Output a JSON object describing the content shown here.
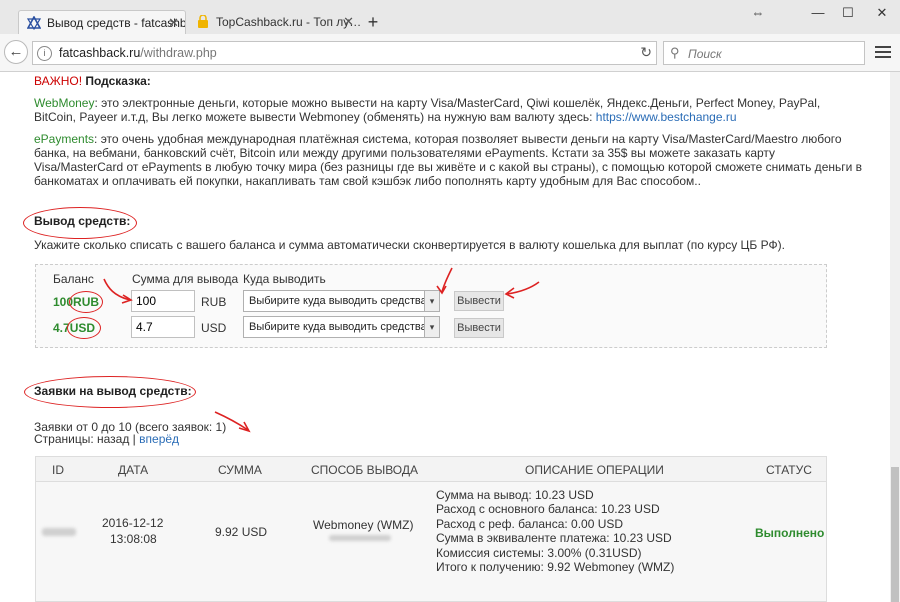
{
  "browser": {
    "tabs": [
      {
        "title": "Вывод средств - fatcashb…",
        "active": true
      },
      {
        "title": "TopCashback.ru - Топ лу…",
        "active": false
      }
    ],
    "new_tab": "+",
    "url_domain": "fatcashback.ru",
    "url_path": "/withdraw.php",
    "search_placeholder": "Поиск"
  },
  "hint": {
    "important": "ВАЖНО!",
    "label": "Подсказка:",
    "webmoney_name": "WebMoney",
    "webmoney_text": ": это электронные деньги, которые можно вывести на карту Visa/MasterCard, Qiwi кошелёк, Яндекс.Деньги, Perfect Money, PayPal, BitCoin, Payeer и.т.д, Вы легко можете вывести Webmoney (обменять) на нужную вам валюту здесь: ",
    "webmoney_link": "https://www.bestchange.ru",
    "epayments_name": "ePayments",
    "epayments_text": ": это очень удобная международная платёжная система, которая позволяет вывести деньги на карту Visa/MasterCard/Maestro любого банка, на вебмани, банковский счёт, Bitcoin или между другими пользователями ePayments. Кстати за 35$ вы можете заказать карту Visa/MasterCard от ePayments в любую точку мира (без разницы где вы живёте и с какой вы страны), с помощью которой сможете снимать деньги в банкоматах и оплачивать ей покупки, накапливать там свой кэшбэк либо пополнять карту удобным для Вас способом.."
  },
  "withdraw": {
    "title": "Вывод средств:",
    "description": "Укажите сколько списать с вашего баланса и сумма автоматически сконвертируется в валюту кошелька для выплат (по курсу ЦБ РФ).",
    "col_balance": "Баланс",
    "col_amount": "Сумма для вывода",
    "col_where": "Куда выводить",
    "rows": [
      {
        "balance": "100",
        "currency_badge": "RUB",
        "amount": "100",
        "currency": "RUB",
        "select": "Выбирите куда выводить средства:",
        "button": "Вывести"
      },
      {
        "balance": "4.7",
        "currency_badge": "USD",
        "amount": "4.7",
        "currency": "USD",
        "select": "Выбирите куда выводить средства:",
        "button": "Вывести"
      }
    ]
  },
  "requests": {
    "title": "Заявки на вывод средств:",
    "summary": "Заявки от 0 до 10 (всего заявок: 1)",
    "pages_label": "Страницы: назад | ",
    "pages_next": "вперёд",
    "headers": [
      "ID",
      "ДАТА",
      "СУММА",
      "СПОСОБ ВЫВОДА",
      "ОПИСАНИЕ ОПЕРАЦИИ",
      "СТАТУС"
    ],
    "row": {
      "date": "2016-12-12",
      "time": "13:08:08",
      "sum": "9.92 USD",
      "method": "Webmoney (WMZ)",
      "description": [
        "Сумма на вывод: 10.23 USD",
        "Расход с основного баланса: 10.23 USD",
        "Расход с реф. баланса: 0.00 USD",
        "Сумма в эквиваленте платежа: 10.23 USD",
        "Комиссия системы: 3.00% (0.31USD)",
        "Итого к получению: 9.92 Webmoney (WMZ)"
      ],
      "status": "Выполнено"
    }
  },
  "colors": {
    "green": "#2e8b2e",
    "link": "#2a6cb6",
    "annotation_red": "#d22"
  }
}
